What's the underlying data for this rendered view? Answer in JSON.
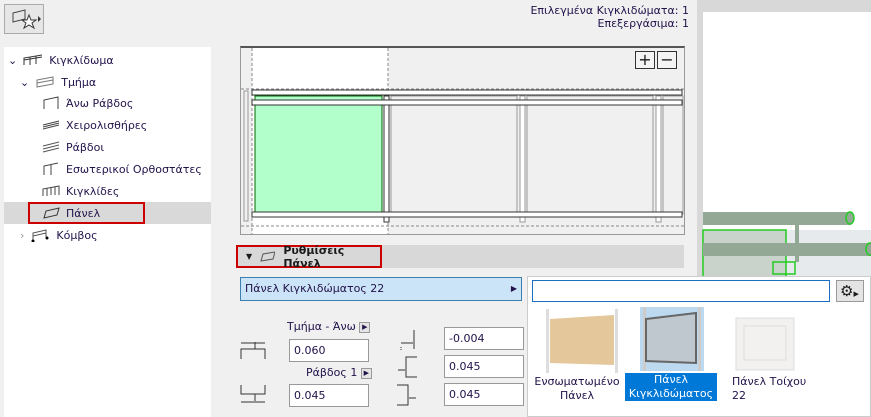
{
  "favorites": {
    "icon": "favorites-star-icon"
  },
  "tree": {
    "items": [
      {
        "label": "Κιγκλίδωμα",
        "level": 0,
        "expanded": true
      },
      {
        "label": "Τμήμα",
        "level": 1,
        "expanded": true
      },
      {
        "label": "Άνω Ράβδος",
        "level": 2
      },
      {
        "label": "Χειρολισθήρες",
        "level": 2
      },
      {
        "label": "Ράβδοι",
        "level": 2
      },
      {
        "label": "Εσωτερικοί Ορθοστάτες",
        "level": 2
      },
      {
        "label": "Κιγκλίδες",
        "level": 2
      },
      {
        "label": "Πάνελ",
        "level": 2,
        "selected": true
      },
      {
        "label": "Κόμβος",
        "level": 1,
        "expanded": false
      }
    ]
  },
  "info": {
    "selected": "Επιλεγμένα Κιγκλιδώματα: 1",
    "editable": "Επεξεργάσιμα: 1"
  },
  "preview": {
    "zoom_in": "+",
    "zoom_out": "−"
  },
  "settings": {
    "title": "Ρυθμίσεις Πάνελ",
    "panel_type": "Πάνελ Κιγκλιδώματος 22",
    "ref_top": "Τμήμα - Άνω",
    "ref_bottom": "Ράβδος 1",
    "top_offset": "0.060",
    "bottom_offset": "0.045",
    "right_values": [
      "-0.004",
      "0.045",
      "0.045"
    ]
  },
  "picker": {
    "search_value": "",
    "items": [
      {
        "label": "Ενσωματωμένο Πάνελ"
      },
      {
        "label": "Πάνελ Κιγκλιδώματος",
        "selected": true
      },
      {
        "label": "Πάνελ Τοίχου 22"
      }
    ]
  },
  "colors": {
    "accent": "#0078d7",
    "highlight": "#cc0000",
    "panel_green": "#b3ffcc"
  }
}
